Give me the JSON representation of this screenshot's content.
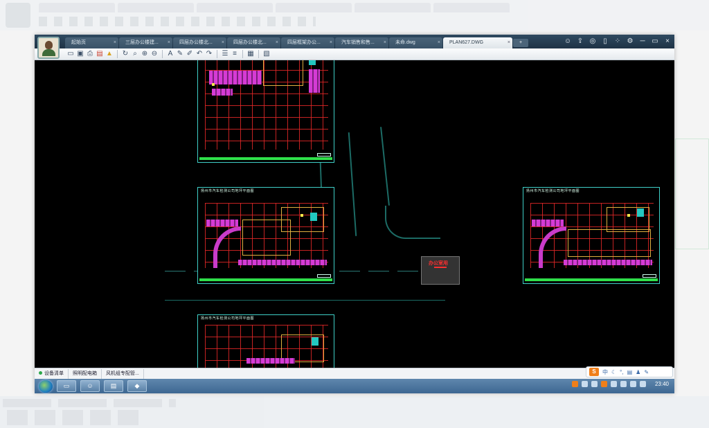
{
  "window": {
    "tabs": [
      {
        "label": "起始页",
        "active": false
      },
      {
        "label": "三层办公楼建...",
        "active": false
      },
      {
        "label": "四层办公楼北...",
        "active": false
      },
      {
        "label": "四层办公楼北...",
        "active": false
      },
      {
        "label": "四层框架办公...",
        "active": false
      },
      {
        "label": "汽车销售和售...",
        "active": false
      },
      {
        "label": "未命.dwg",
        "active": false
      },
      {
        "label": "PLAN627.DWG",
        "active": true
      }
    ],
    "tab_close": "×",
    "new_tab": "+",
    "controls": [
      "minimize",
      "restore",
      "close"
    ],
    "control_glyphs": [
      "─",
      "▭",
      "×"
    ]
  },
  "toolbar": {
    "icons": [
      "open-icon",
      "save-icon",
      "print-icon",
      "export-icon",
      "lock-icon",
      "refresh-icon",
      "zoom-window-icon",
      "zoom-in-icon",
      "zoom-out-icon",
      "text-icon",
      "pencil-icon",
      "marker-icon",
      "undo-icon",
      "redo-icon",
      "layer-icon",
      "measure-icon",
      "table-icon",
      "properties-icon"
    ]
  },
  "drawing": {
    "sheet_titles": [
      "扬州市汽车检测公司地坪平面图",
      "扬州市汽车检测公司地坪平面图",
      "扬州市汽车检测公司地坪平面图",
      "扬州市汽车检测公司地坪平面图"
    ],
    "legend_label": "办公室用"
  },
  "bottom_tabs": [
    {
      "label": "设备清单",
      "has_dot": true
    },
    {
      "label": "照明配电箱",
      "has_dot": false
    },
    {
      "label": "风机组专配管...",
      "has_dot": false
    }
  ],
  "ime": {
    "brand": "S",
    "label": "中"
  },
  "taskbar": {
    "apps": [
      "explorer-icon",
      "user-icon",
      "stack-icon",
      "cad-icon"
    ],
    "clock": "23:40"
  },
  "colors": {
    "canvas": "#000000",
    "sheet_border": "#3fd0c8",
    "grid": "#e62828",
    "magenta": "#d53bd5",
    "green_bar": "#2fe04a",
    "road": "#1c6b65"
  }
}
